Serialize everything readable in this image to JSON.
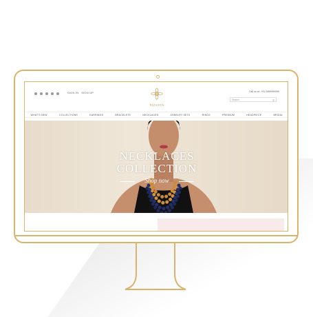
{
  "site": {
    "logo_text": "NIZANTA",
    "sign_in": "SIGN IN",
    "sign_up": "SIGN UP",
    "contact": "Call us on: +91-9999999999",
    "search_placeholder": "Search",
    "nav": [
      "WHAT'S NEW",
      "COLLECTIONS",
      "EARRINGS",
      "BRACELETS",
      "NECKLACES",
      "JEWELRY SETS",
      "RINGS",
      "PREMIUM",
      "HEADPIECE",
      "BRIDAL"
    ]
  },
  "hero": {
    "line1": "NECKLACES",
    "line2": "COLLECTION",
    "cta": "Shop now"
  },
  "colors": {
    "gold": "#d9b36b",
    "hero_bg": "#e7dccb",
    "pink_bar": "#f8eaea"
  }
}
